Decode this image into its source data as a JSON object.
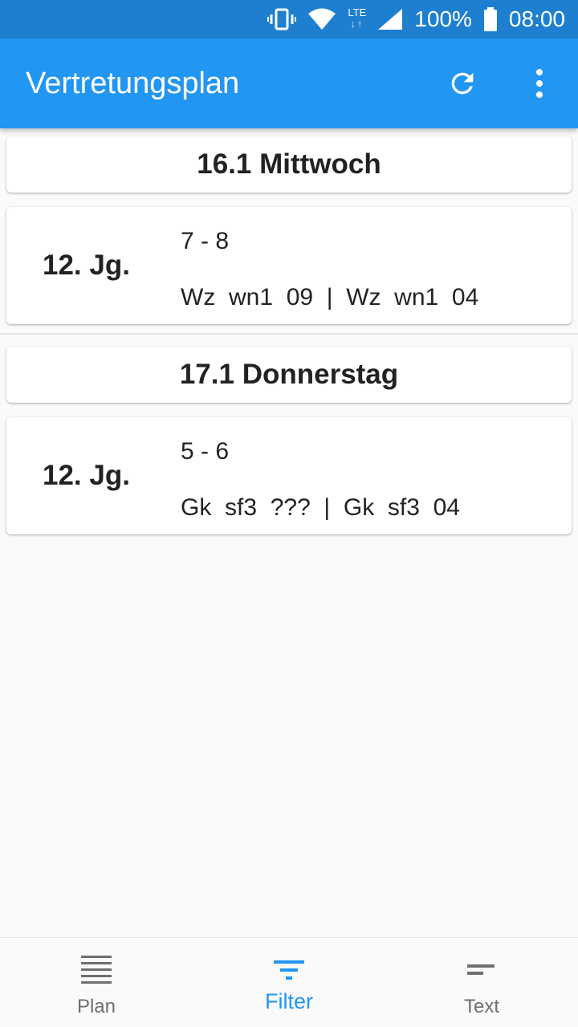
{
  "status_bar": {
    "network": "LTE",
    "battery": "100%",
    "time": "08:00"
  },
  "app_bar": {
    "title": "Vertretungsplan",
    "refresh_icon": "refresh-icon",
    "more_icon": "more-vert-icon"
  },
  "days": [
    {
      "header": "16.1 Mittwoch",
      "entries": [
        {
          "grade": "12. Jg.",
          "hours": "7 - 8",
          "detail": "Wz  wn1  09  |  Wz  wn1  04"
        }
      ]
    },
    {
      "header": "17.1 Donnerstag",
      "entries": [
        {
          "grade": "12. Jg.",
          "hours": "5 - 6",
          "detail": "Gk  sf3  ???  |  Gk  sf3  04"
        }
      ]
    }
  ],
  "bottom_nav": {
    "items": [
      {
        "label": "Plan",
        "icon": "list-icon",
        "active": false
      },
      {
        "label": "Filter",
        "icon": "filter-icon",
        "active": true
      },
      {
        "label": "Text",
        "icon": "short-text-icon",
        "active": false
      }
    ]
  },
  "colors": {
    "status_bar": "#1e7fd0",
    "primary": "#2196f3",
    "background": "#fafafa",
    "inactive_nav": "#6f6f6f"
  }
}
